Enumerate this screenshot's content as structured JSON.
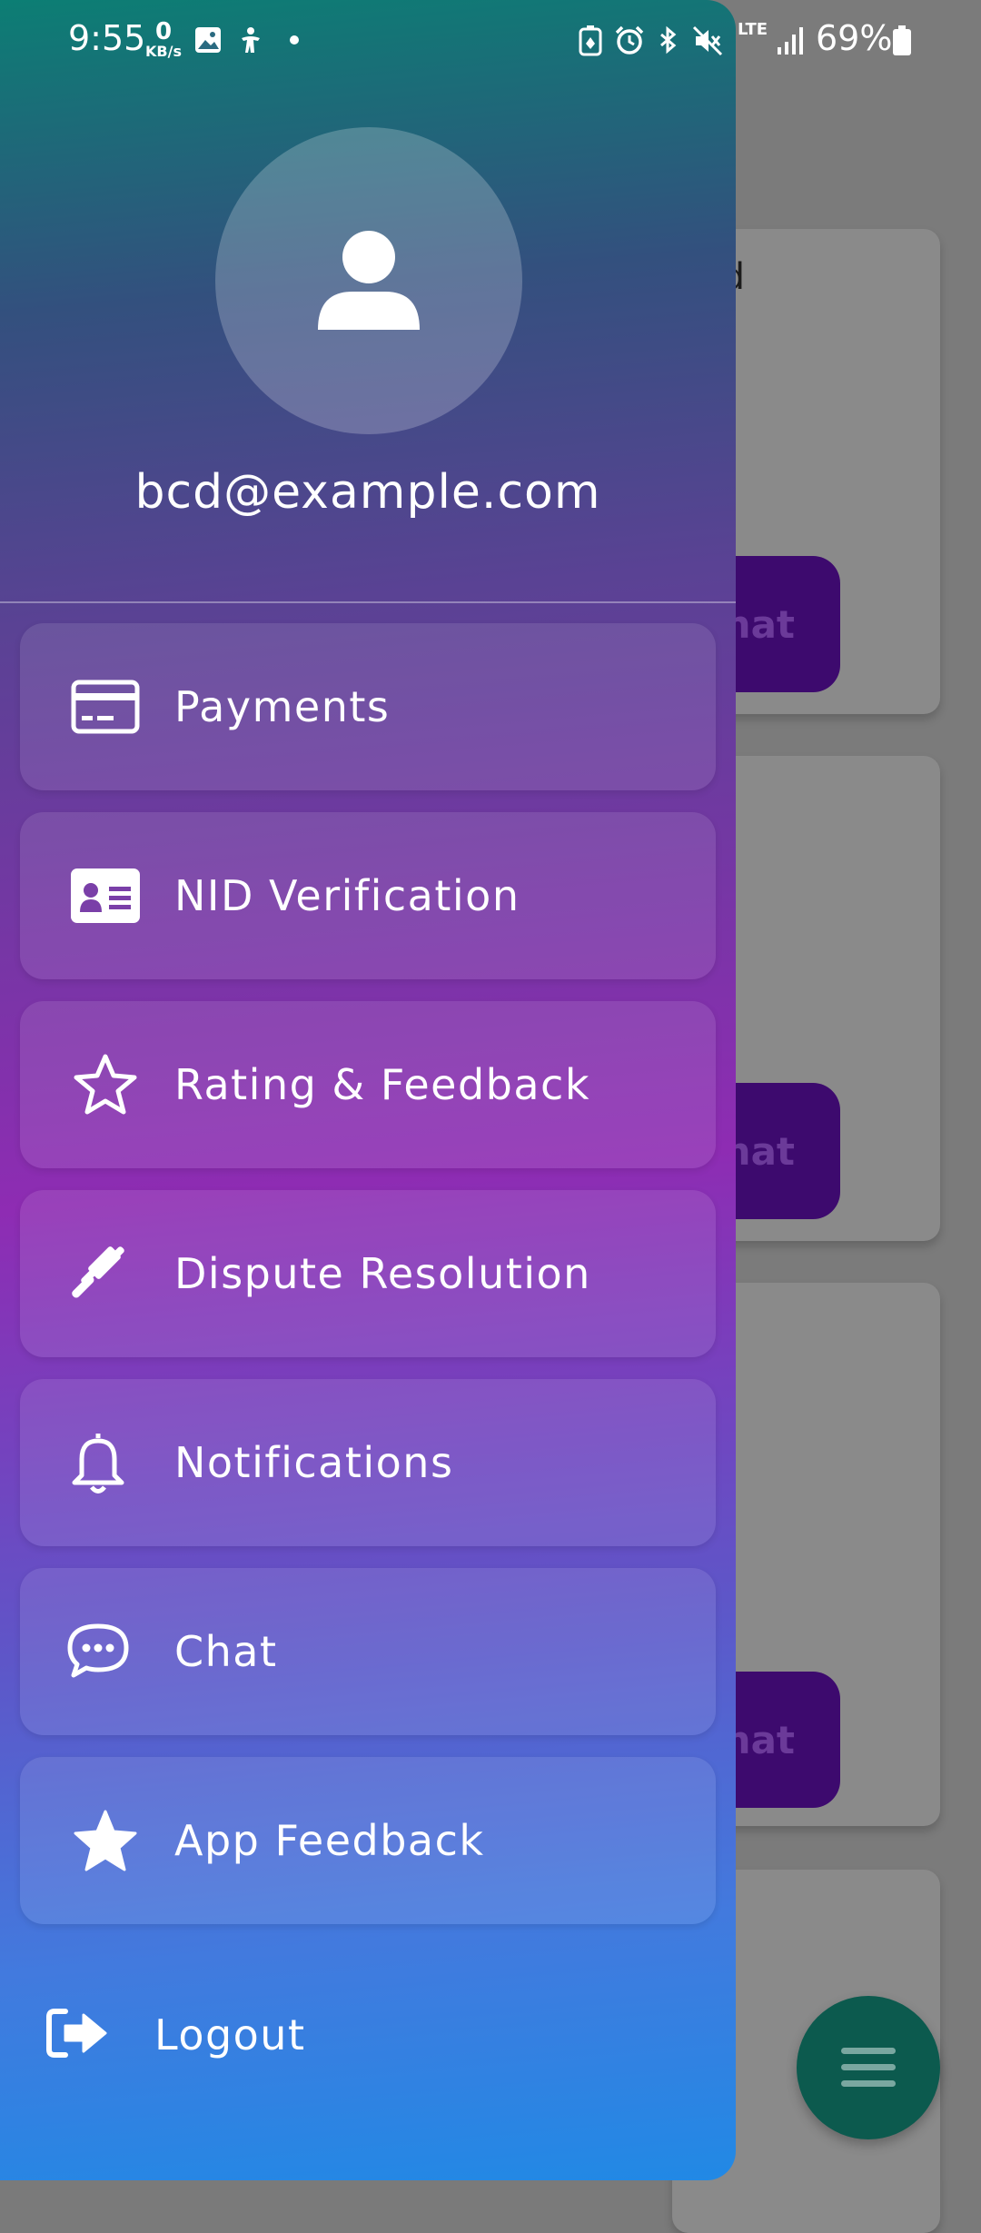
{
  "status_bar": {
    "time": "9:55",
    "net_speed_value": "0",
    "net_speed_unit": "KB/s",
    "network": "LTE",
    "battery": "69%"
  },
  "drawer": {
    "email": "bcd@example.com",
    "menu": [
      {
        "label": "Payments",
        "icon": "credit-card-icon"
      },
      {
        "label": "NID Verification",
        "icon": "id-card-icon"
      },
      {
        "label": "Rating & Feedback",
        "icon": "star-outline-icon"
      },
      {
        "label": "Dispute Resolution",
        "icon": "gavel-icon"
      },
      {
        "label": "Notifications",
        "icon": "bell-icon"
      },
      {
        "label": "Chat",
        "icon": "chat-bubble-icon"
      },
      {
        "label": "App Feedback",
        "icon": "star-filled-icon"
      }
    ],
    "logout_label": "Logout"
  },
  "background": {
    "card_text_fragment": "ed",
    "chat_button_fragment": "hat"
  },
  "colors": {
    "gradient_top": "#0c7e74",
    "gradient_mid": "#8e2cb3",
    "gradient_bottom": "#2189e5",
    "fab": "#0c5a4e",
    "chat_button": "#3d0a6e"
  }
}
